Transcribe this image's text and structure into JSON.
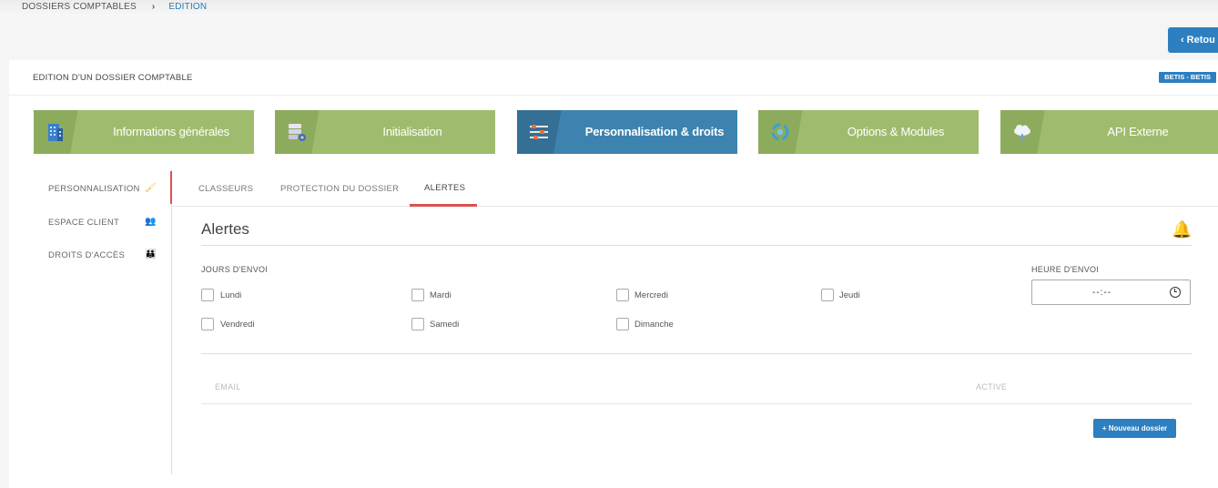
{
  "breadcrumb": {
    "items": [
      "DOSSIERS COMPTABLES",
      "EDITION"
    ],
    "separator": "›"
  },
  "back_button": "Retou",
  "panel": {
    "title": "EDITION D'UN DOSSIER COMPTABLE",
    "badge": "BETIS - BETIS"
  },
  "main_tabs": [
    {
      "label": "Informations générales",
      "icon": "building-icon"
    },
    {
      "label": "Initialisation",
      "icon": "server-gear-icon"
    },
    {
      "label": "Personnalisation & droits",
      "icon": "sliders-icon",
      "active": true
    },
    {
      "label": "Options & Modules",
      "icon": "recycle-icon"
    },
    {
      "label": "API Externe",
      "icon": "cloud-icon"
    }
  ],
  "side_nav": [
    {
      "label": "PERSONNALISATION",
      "icon": "brush-icon",
      "active": true
    },
    {
      "label": "ESPACE CLIENT",
      "icon": "users-icon"
    },
    {
      "label": "DROITS D'ACCÈS",
      "icon": "people-icon"
    }
  ],
  "sub_tabs": [
    "CLASSEURS",
    "PROTECTION DU DOSSIER",
    "ALERTES"
  ],
  "sub_tab_active": "ALERTES",
  "section": {
    "title": "Alertes",
    "days_label": "JOURS D'ENVOI",
    "days": [
      "Lundi",
      "Mardi",
      "Mercredi",
      "Jeudi",
      "Vendredi",
      "Samedi",
      "Dimanche"
    ],
    "time_label": "HEURE D'ENVOI",
    "time_value": "--:--"
  },
  "table": {
    "columns": [
      "EMAIL",
      "ACTIVE"
    ]
  },
  "new_button": "+ Nouveau dossier",
  "colors": {
    "accent": "#2d7fc0",
    "tab_green": "#9fbc6e",
    "tab_active": "#3d83b0",
    "underline": "#d9534f"
  }
}
